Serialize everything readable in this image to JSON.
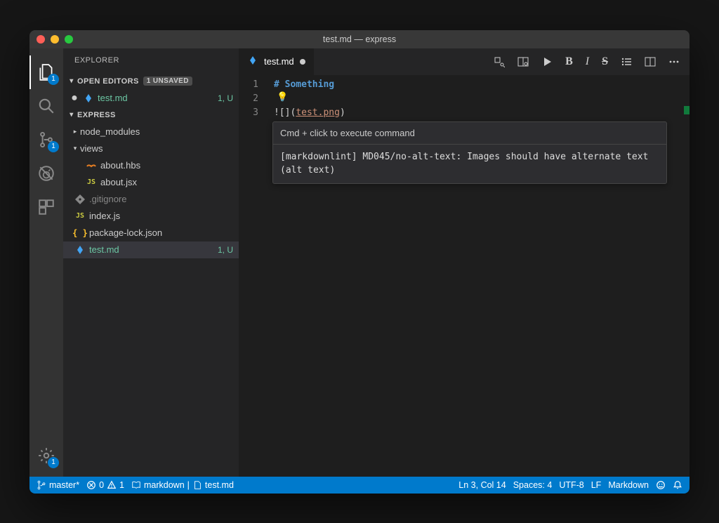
{
  "title": "test.md — express",
  "activity": {
    "explorer_badge": "1",
    "scm_badge": "1",
    "settings_badge": "1"
  },
  "sidebar": {
    "header": "EXPLORER",
    "open_editors_label": "OPEN EDITORS",
    "unsaved_badge": "1 UNSAVED",
    "open_editors": [
      {
        "name": "test.md",
        "status": "1, U"
      }
    ],
    "workspace_label": "EXPRESS",
    "tree": {
      "node_modules": "node_modules",
      "views": "views",
      "about_hbs": "about.hbs",
      "about_jsx": "about.jsx",
      "gitignore": ".gitignore",
      "index_js": "index.js",
      "package_lock": "package-lock.json",
      "test_md": "test.md",
      "test_md_status": "1, U"
    }
  },
  "tab": {
    "filename": "test.md"
  },
  "editor": {
    "line1_hash": "#",
    "line1_text": " Something",
    "line3_prefix": "![](",
    "line3_url": "test.png",
    "line3_suffix": ")",
    "line_numbers": [
      "1",
      "2",
      "3"
    ]
  },
  "hover": {
    "cmd": "Cmd + click to execute command",
    "lint": "[markdownlint] MD045/no-alt-text: Images should have alternate text (alt text)"
  },
  "status": {
    "branch": "master*",
    "errors": "0",
    "warnings": "1",
    "md_label": "markdown",
    "file": "test.md",
    "ln_col": "Ln 3, Col 14",
    "spaces": "Spaces: 4",
    "encoding": "UTF-8",
    "eol": "LF",
    "language": "Markdown"
  }
}
